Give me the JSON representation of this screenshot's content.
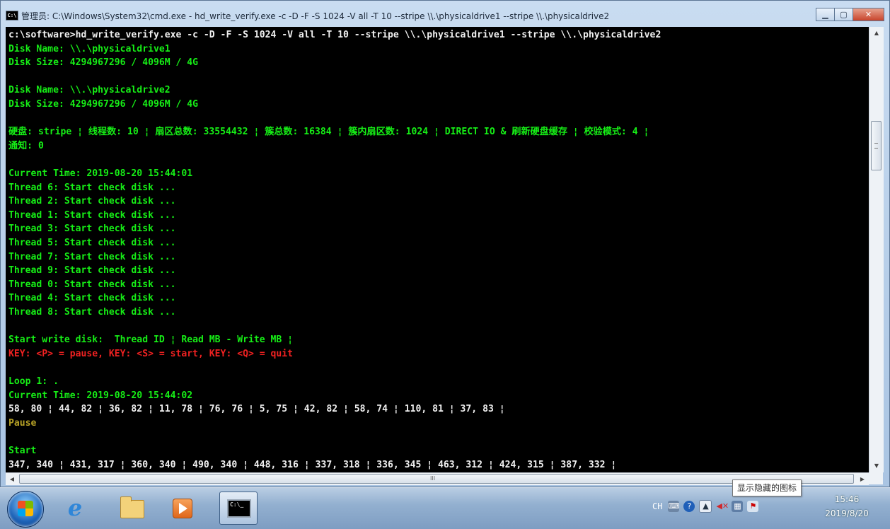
{
  "window": {
    "title": "管理员: C:\\Windows\\System32\\cmd.exe - hd_write_verify.exe  -c -D -F -S 1024 -V all -T 10 --stripe \\\\.\\physicaldrive1 --stripe \\\\.\\physicaldrive2",
    "icon": "cmd-icon",
    "minimize_icon": "minimize-icon",
    "maximize_icon": "maximize-icon",
    "close_icon": "close-icon"
  },
  "console": {
    "lines": [
      {
        "text": "c:\\software>hd_write_verify.exe -c -D -F -S 1024 -V all -T 10 --stripe \\\\.\\physicaldrive1 --stripe \\\\.\\physicaldrive2",
        "color": "#f0f0f0"
      },
      {
        "text": "Disk Name: \\\\.\\physicaldrive1",
        "color": "#16ee16"
      },
      {
        "text": "Disk Size: 4294967296 / 4096M / 4G",
        "color": "#16ee16"
      },
      {
        "text": "",
        "color": "#16ee16"
      },
      {
        "text": "Disk Name: \\\\.\\physicaldrive2",
        "color": "#16ee16"
      },
      {
        "text": "Disk Size: 4294967296 / 4096M / 4G",
        "color": "#16ee16"
      },
      {
        "text": "",
        "color": "#16ee16"
      },
      {
        "text": "硬盘: stripe ¦ 线程数: 10 ¦ 扇区总数: 33554432 ¦ 簇总数: 16384 ¦ 簇内扇区数: 1024 ¦ DIRECT IO & 刷新硬盘缓存 ¦ 校验模式: 4 ¦",
        "color": "#16ee16"
      },
      {
        "text": "通知: 0",
        "color": "#16ee16"
      },
      {
        "text": "",
        "color": "#16ee16"
      },
      {
        "text": "Current Time: 2019-08-20 15:44:01",
        "color": "#16ee16"
      },
      {
        "text": "Thread 6: Start check disk ...",
        "color": "#16ee16"
      },
      {
        "text": "Thread 2: Start check disk ...",
        "color": "#16ee16"
      },
      {
        "text": "Thread 1: Start check disk ...",
        "color": "#16ee16"
      },
      {
        "text": "Thread 3: Start check disk ...",
        "color": "#16ee16"
      },
      {
        "text": "Thread 5: Start check disk ...",
        "color": "#16ee16"
      },
      {
        "text": "Thread 7: Start check disk ...",
        "color": "#16ee16"
      },
      {
        "text": "Thread 9: Start check disk ...",
        "color": "#16ee16"
      },
      {
        "text": "Thread 0: Start check disk ...",
        "color": "#16ee16"
      },
      {
        "text": "Thread 4: Start check disk ...",
        "color": "#16ee16"
      },
      {
        "text": "Thread 8: Start check disk ...",
        "color": "#16ee16"
      },
      {
        "text": "",
        "color": "#16ee16"
      },
      {
        "text": "Start write disk:  Thread ID ¦ Read MB - Write MB ¦",
        "color": "#16ee16"
      },
      {
        "text": "KEY: <P> = pause, KEY: <S> = start, KEY: <Q> = quit",
        "color": "#ef2121"
      },
      {
        "text": "",
        "color": "#16ee16"
      },
      {
        "text": "Loop 1: .",
        "color": "#16ee16"
      },
      {
        "text": "Current Time: 2019-08-20 15:44:02",
        "color": "#16ee16"
      },
      {
        "text": "58, 80 ¦ 44, 82 ¦ 36, 82 ¦ 11, 78 ¦ 76, 76 ¦ 5, 75 ¦ 42, 82 ¦ 58, 74 ¦ 110, 81 ¦ 37, 83 ¦",
        "color": "#f0f0f0"
      },
      {
        "text": "Pause",
        "color": "#b5a026"
      },
      {
        "text": "",
        "color": "#16ee16"
      },
      {
        "text": "Start",
        "color": "#16ee16"
      },
      {
        "text": "347, 340 ¦ 431, 317 ¦ 360, 340 ¦ 490, 340 ¦ 448, 316 ¦ 337, 318 ¦ 336, 345 ¦ 463, 312 ¦ 424, 315 ¦ 387, 332 ¦",
        "color": "#f0f0f0"
      }
    ]
  },
  "scrollbars": {
    "up_icon": "scroll-up-arrow-icon",
    "down_icon": "scroll-down-arrow-icon",
    "left_icon": "scroll-left-arrow-icon",
    "right_icon": "scroll-right-arrow-icon",
    "h_grip": "III"
  },
  "tooltip": {
    "text": "显示隐藏的图标"
  },
  "taskbar": {
    "start": "windows-start-icon",
    "pinned": [
      "ie-icon",
      "folder-icon",
      "media-player-icon",
      "cmd-icon"
    ],
    "tray": {
      "ime": "CH",
      "icons": [
        "keyboard-icon",
        "help-icon",
        "show-hidden-icons-icon",
        "volume-muted-icon",
        "network-icon",
        "action-center-icon"
      ]
    },
    "clock": {
      "time": "15:46",
      "date": "2019/8/20"
    }
  }
}
